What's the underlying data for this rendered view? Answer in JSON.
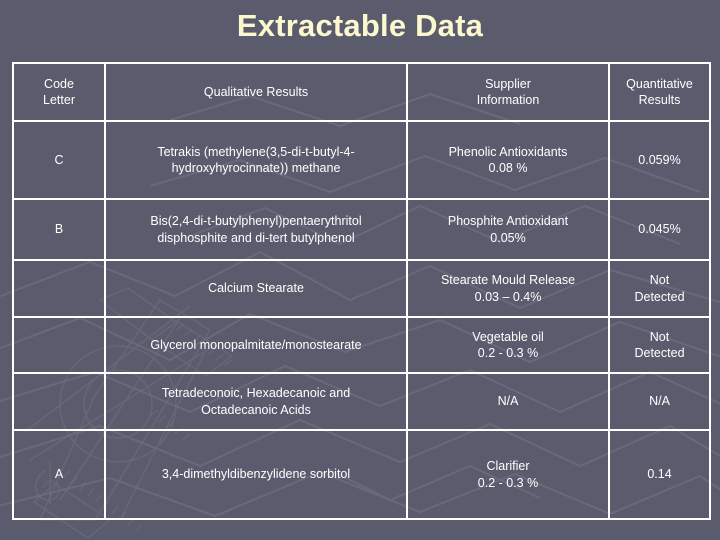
{
  "slide": {
    "title": "Extractable Data",
    "title_color": "#fbf7cf",
    "background_color": "#5a5c6d",
    "border_color": "#ffffff",
    "text_color": "#ffffff"
  },
  "table": {
    "columns": [
      {
        "id": "code",
        "header_line1": "Code",
        "header_line2": "Letter"
      },
      {
        "id": "qual",
        "header_line1": "Qualitative Results",
        "header_line2": ""
      },
      {
        "id": "supp",
        "header_line1": "Supplier",
        "header_line2": "Information"
      },
      {
        "id": "quant",
        "header_line1": "Quantitative",
        "header_line2": "Results"
      }
    ],
    "rows": [
      {
        "code": "C",
        "qual_line1": "Tetrakis (methylene(3,5-di-t-butyl-4-",
        "qual_line2": "hydroxyhyrocinnate)) methane",
        "supp_line1": "Phenolic Antioxidants",
        "supp_line2": "0.08 %",
        "quant": "0.059%"
      },
      {
        "code": "B",
        "qual_line1": "Bis(2,4-di-t-butylphenyl)pentaerythritol",
        "qual_line2": "disphosphite and di-tert butylphenol",
        "supp_line1": "Phosphite Antioxidant",
        "supp_line2": "0.05%",
        "quant": "0.045%"
      },
      {
        "code": "",
        "qual_line1": "Calcium Stearate",
        "qual_line2": "",
        "supp_line1": "Stearate Mould Release",
        "supp_line2": "0.03 – 0.4%",
        "quant_line1": "Not",
        "quant_line2": "Detected",
        "quant": ""
      },
      {
        "code": "",
        "qual_line1": "Glycerol monopalmitate/monostearate",
        "qual_line2": "",
        "supp_line1": "Vegetable oil",
        "supp_line2": "0.2 - 0.3 %",
        "quant_line1": "Not",
        "quant_line2": "Detected",
        "quant": ""
      },
      {
        "code": "",
        "qual_line1": "Tetradeconoic, Hexadecanoic  and",
        "qual_line2": "Octadecanoic Acids",
        "supp_line1": "N/A",
        "supp_line2": "",
        "quant": "N/A"
      },
      {
        "code": "A",
        "qual_line1": "3,4-dimethyldibenzylidene sorbitol",
        "qual_line2": "",
        "supp_line1": "Clarifier",
        "supp_line2": "0.2 - 0.3 %",
        "quant": "0.14"
      }
    ]
  }
}
